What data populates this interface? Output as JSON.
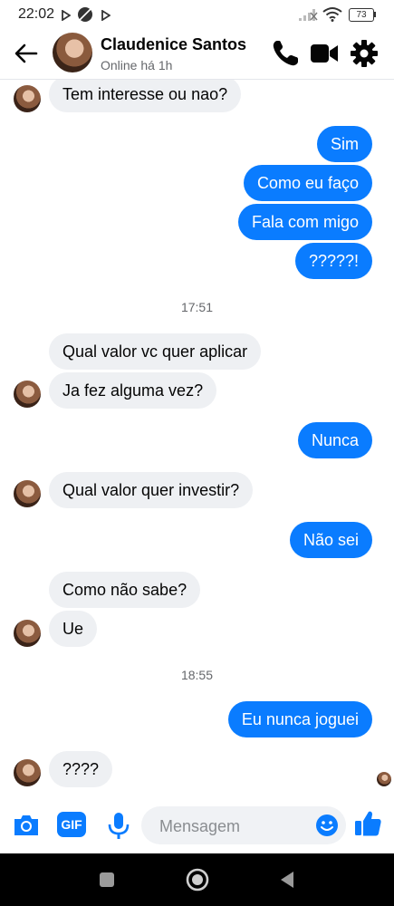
{
  "status_bar": {
    "time": "22:02",
    "battery": "73"
  },
  "header": {
    "name": "Claudenice Santos",
    "status": "Online há 1h"
  },
  "messages": [
    {
      "dir": "in",
      "text": "Tem interesse ou nao?",
      "avatar": true
    },
    {
      "dir": "out",
      "text": "Sim"
    },
    {
      "dir": "out",
      "text": "Como eu faço"
    },
    {
      "dir": "out",
      "text": "Fala com migo"
    },
    {
      "dir": "out",
      "text": "?????!"
    },
    {
      "dir": "in",
      "text": "Qual valor vc quer aplicar",
      "avatar": false
    },
    {
      "dir": "in",
      "text": "Ja fez alguma vez?",
      "avatar": true
    },
    {
      "dir": "out",
      "text": "Nunca"
    },
    {
      "dir": "in",
      "text": "Qual valor quer investir?",
      "avatar": true
    },
    {
      "dir": "out",
      "text": "Não sei"
    },
    {
      "dir": "in",
      "text": "Como não sabe?",
      "avatar": false
    },
    {
      "dir": "in",
      "text": "Ue",
      "avatar": true
    },
    {
      "dir": "out",
      "text": "Eu nunca joguei"
    },
    {
      "dir": "in",
      "text": "????",
      "avatar": true
    }
  ],
  "timestamps": [
    "17:51",
    "18:55"
  ],
  "composer": {
    "placeholder": "Mensagem",
    "gif_label": "GIF"
  },
  "colors": {
    "accent": "#0a7cff",
    "incoming_bubble": "#eef0f3"
  }
}
